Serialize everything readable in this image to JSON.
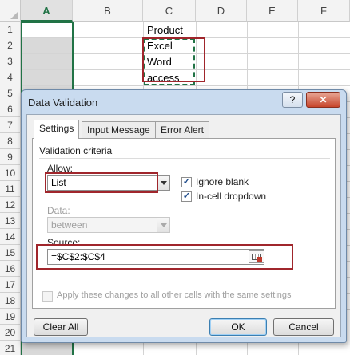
{
  "sheet": {
    "columns": [
      "A",
      "B",
      "C",
      "D",
      "E",
      "F"
    ],
    "rows": [
      "1",
      "2",
      "3",
      "4",
      "5",
      "6",
      "7",
      "8",
      "9",
      "10",
      "11",
      "12",
      "13",
      "14",
      "15",
      "16",
      "17",
      "18",
      "19",
      "20",
      "21"
    ],
    "cells": {
      "C1": "Product",
      "C2": "Excel",
      "C3": "Word",
      "C4": "access"
    }
  },
  "dialog": {
    "title": "Data Validation",
    "help_label": "?",
    "close_label": "✕",
    "tabs": [
      "Settings",
      "Input Message",
      "Error Alert"
    ],
    "validation_criteria_label": "Validation criteria",
    "allow_label": "Allow:",
    "allow_value": "List",
    "ignore_blank_label": "Ignore blank",
    "ignore_blank_checked": true,
    "in_cell_dropdown_label": "In-cell dropdown",
    "in_cell_dropdown_checked": true,
    "data_label": "Data:",
    "data_value": "between",
    "source_label": "Source:",
    "source_value": "=$C$2:$C$4",
    "apply_all_label": "Apply these changes to all other cells with the same settings",
    "apply_all_checked": false,
    "clear_all_label": "Clear All",
    "ok_label": "OK",
    "cancel_label": "Cancel"
  },
  "colors": {
    "accent": "#217346",
    "highlight": "#a0262c"
  },
  "icons": {
    "range_selector": "range-select-icon",
    "checkbox_mark": "check-icon"
  }
}
